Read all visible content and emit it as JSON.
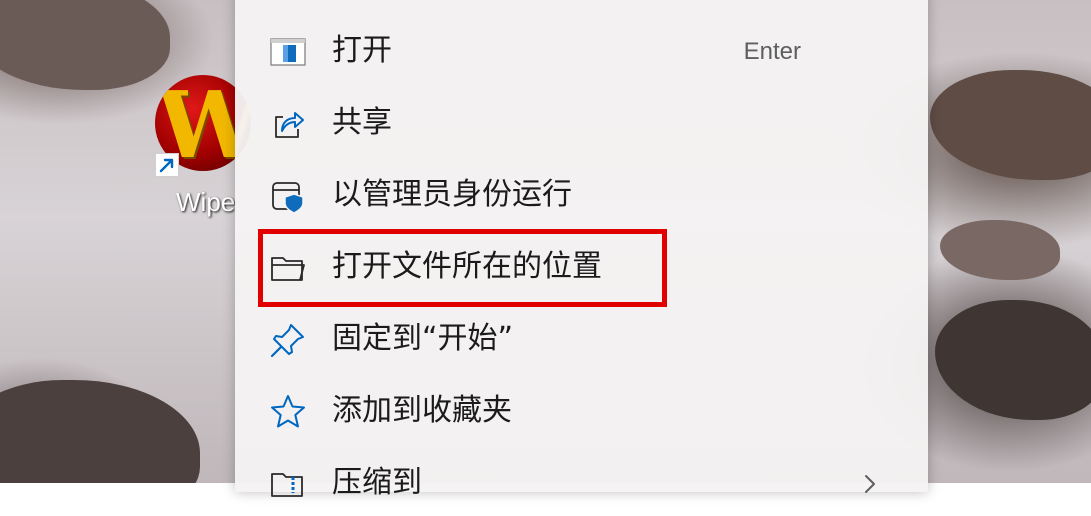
{
  "desktop": {
    "shortcut": {
      "label": "Wipe",
      "logo_letter": "W",
      "icon": "app-logo-icon",
      "overlay_icon": "shortcut-arrow-icon"
    }
  },
  "context_menu": {
    "items": [
      {
        "label": "打开",
        "shortcut": "Enter",
        "icon": "open-window-icon"
      },
      {
        "label": "共享",
        "icon": "share-icon"
      },
      {
        "label": "以管理员身份运行",
        "icon": "shield-admin-icon"
      },
      {
        "label": "打开文件所在的位置",
        "icon": "folder-icon",
        "highlighted": true
      },
      {
        "label": "固定到“开始”",
        "icon": "pin-icon"
      },
      {
        "label": "添加到收藏夹",
        "icon": "star-icon"
      },
      {
        "label": "压缩到",
        "icon": "zip-folder-icon",
        "submenu": true
      }
    ]
  },
  "colors": {
    "accent": "#0067c0",
    "highlight_border": "#e00000",
    "menu_background": "#f5f2f3"
  }
}
